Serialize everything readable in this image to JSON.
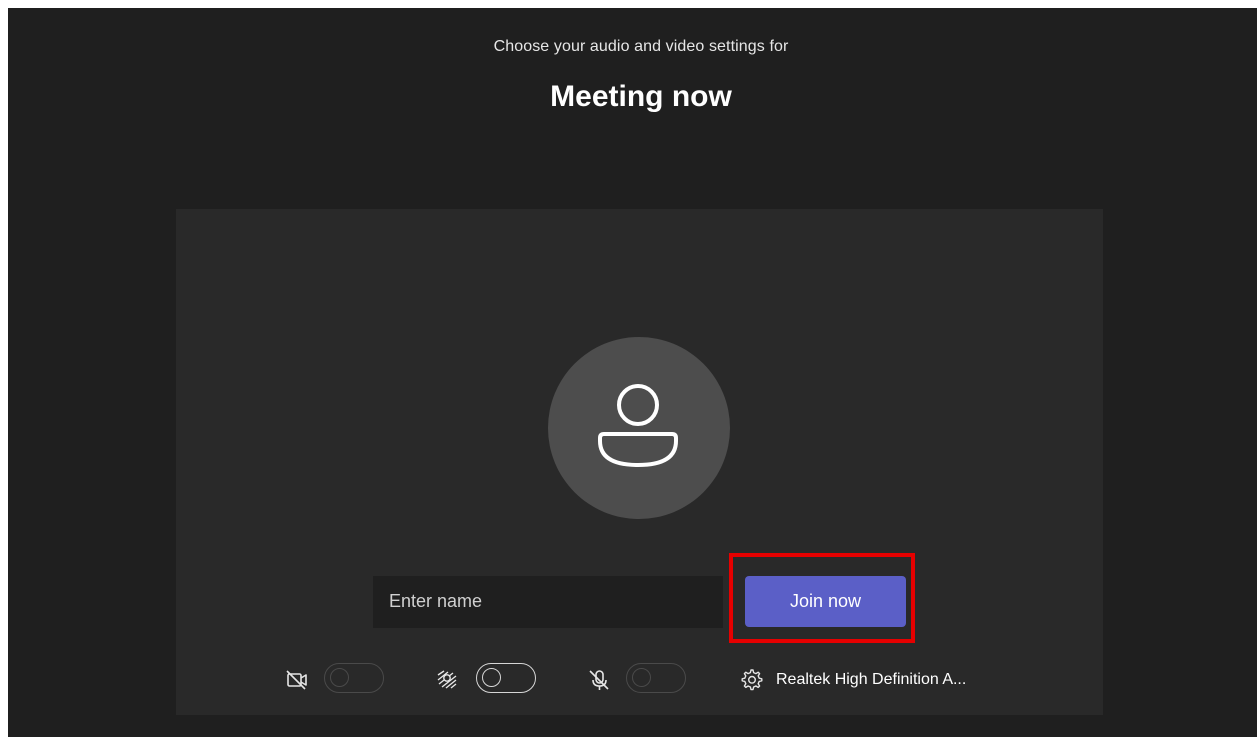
{
  "header": {
    "subtitle": "Choose your audio and video settings for",
    "meeting_title": "Meeting now"
  },
  "name_field": {
    "placeholder": "Enter name",
    "value": ""
  },
  "join_button": {
    "label": "Join now",
    "color": "#5b5fc7"
  },
  "controls": {
    "camera": {
      "icon": "camera-off-icon",
      "state": "off"
    },
    "background_effects": {
      "icon": "background-blur-icon",
      "state": "off"
    },
    "microphone": {
      "icon": "microphone-off-icon",
      "state": "off"
    },
    "audio_device": {
      "icon": "gear-icon",
      "label": "Realtek High Definition A..."
    }
  },
  "highlight_color": "#e60000"
}
